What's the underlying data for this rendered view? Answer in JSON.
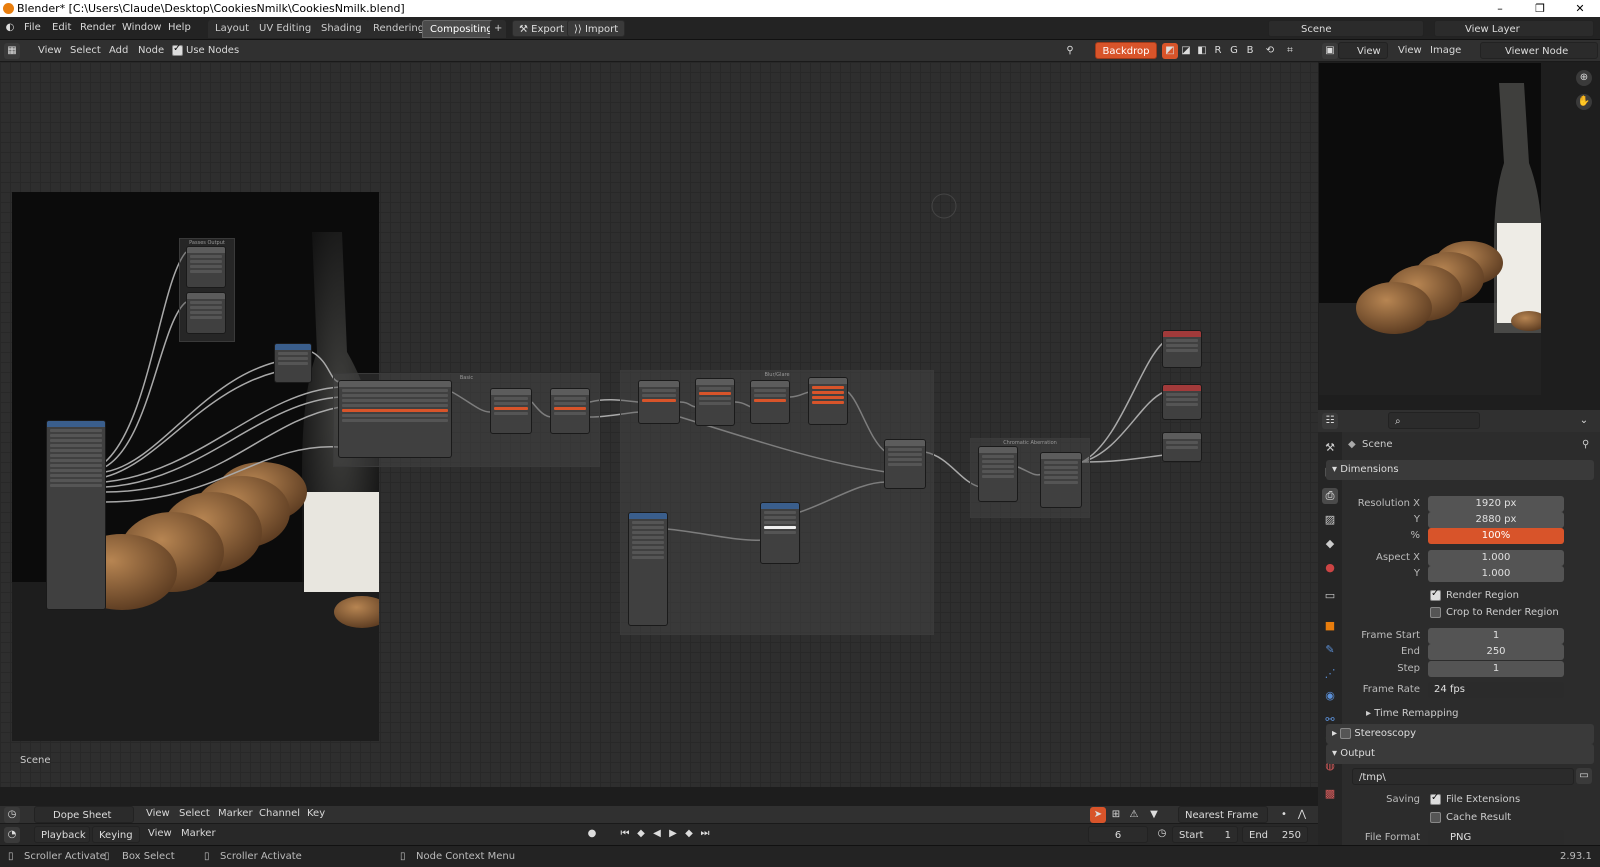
{
  "window": {
    "title": "Blender* [C:\\Users\\Claude\\Desktop\\CookiesNmilk\\CookiesNmilk.blend]",
    "minimize": "–",
    "maximize": "❐",
    "close": "✕"
  },
  "menu": {
    "file": "File",
    "edit": "Edit",
    "render": "Render",
    "window": "Window",
    "help": "Help"
  },
  "workspaces": [
    "Layout",
    "UV Editing",
    "Shading",
    "Rendering",
    "Compositing"
  ],
  "active_workspace": "Compositing",
  "topbar": {
    "add_tab": "+",
    "export": "Export",
    "import": "Import",
    "scene": "Scene",
    "view_layer": "View Layer"
  },
  "node_header": {
    "view": "View",
    "select": "Select",
    "add": "Add",
    "node": "Node",
    "use_nodes": "Use Nodes",
    "backdrop": "Backdrop",
    "channel_r": "R",
    "channel_g": "G",
    "channel_b": "B"
  },
  "node_editor": {
    "scene_label": "Scene"
  },
  "image_editor": {
    "view_menu": "View",
    "view": "View",
    "image": "Image",
    "viewer_node": "Viewer Node"
  },
  "properties": {
    "scene": "Scene",
    "dimensions": {
      "header": "Dimensions",
      "resolution_x_label": "Resolution X",
      "resolution_x": "1920 px",
      "y_label": "Y",
      "resolution_y": "2880 px",
      "pct_label": "%",
      "percentage": "100%",
      "aspect_x_label": "Aspect X",
      "aspect_x": "1.000",
      "aspect_y_label": "Y",
      "aspect_y": "1.000",
      "render_region": "Render Region",
      "crop_to_render_region": "Crop to Render Region",
      "frame_start_label": "Frame Start",
      "frame_start": "1",
      "end_label": "End",
      "frame_end": "250",
      "step_label": "Step",
      "frame_step": "1",
      "frame_rate_label": "Frame Rate",
      "frame_rate": "24 fps",
      "time_remapping": "Time Remapping"
    },
    "stereoscopy": "Stereoscopy",
    "output": {
      "header": "Output",
      "path": "/tmp\\",
      "saving_label": "Saving",
      "file_extensions": "File Extensions",
      "cache_result": "Cache Result",
      "file_format_label": "File Format",
      "file_format": "PNG"
    }
  },
  "dope_sheet": {
    "editor": "Dope Sheet",
    "view": "View",
    "select": "Select",
    "marker": "Marker",
    "channel": "Channel",
    "key": "Key",
    "snap": "Nearest Frame"
  },
  "timeline": {
    "playback": "Playback",
    "keying": "Keying",
    "view": "View",
    "marker": "Marker",
    "current_frame": "6",
    "start_label": "Start",
    "start": "1",
    "end_label": "End",
    "end": "250"
  },
  "status": {
    "left1": "Scroller Activate",
    "left2": "Box Select",
    "left3": "Scroller Activate",
    "left4": "Node Context Menu",
    "version": "2.93.1"
  }
}
